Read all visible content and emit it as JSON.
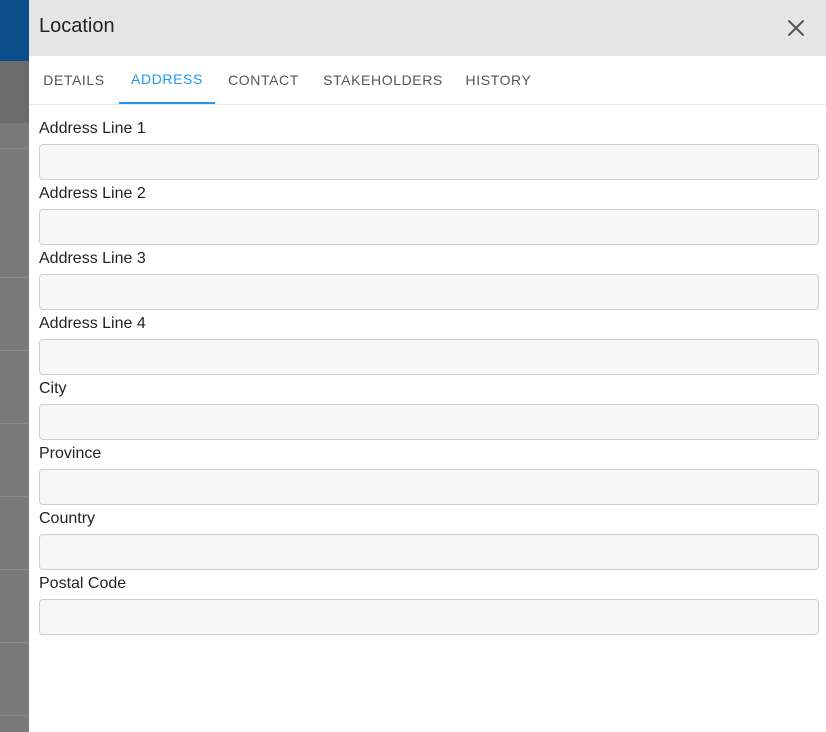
{
  "dialog": {
    "title": "Location",
    "close_icon": "close-icon"
  },
  "tabs": [
    {
      "label": "DETAILS",
      "active": false
    },
    {
      "label": "ADDRESS",
      "active": true
    },
    {
      "label": "CONTACT",
      "active": false
    },
    {
      "label": "STAKEHOLDERS",
      "active": false
    },
    {
      "label": "HISTORY",
      "active": false
    }
  ],
  "form": {
    "fields": [
      {
        "label": "Address Line 1",
        "value": ""
      },
      {
        "label": "Address Line 2",
        "value": ""
      },
      {
        "label": "Address Line 3",
        "value": ""
      },
      {
        "label": "Address Line 4",
        "value": ""
      },
      {
        "label": "City",
        "value": ""
      },
      {
        "label": "Province",
        "value": ""
      },
      {
        "label": "Country",
        "value": ""
      },
      {
        "label": "Postal Code",
        "value": ""
      }
    ]
  },
  "colors": {
    "accent": "#2196f3",
    "header_bg": "#e5e5e5",
    "backdrop_bar": "#0d4f8a"
  }
}
